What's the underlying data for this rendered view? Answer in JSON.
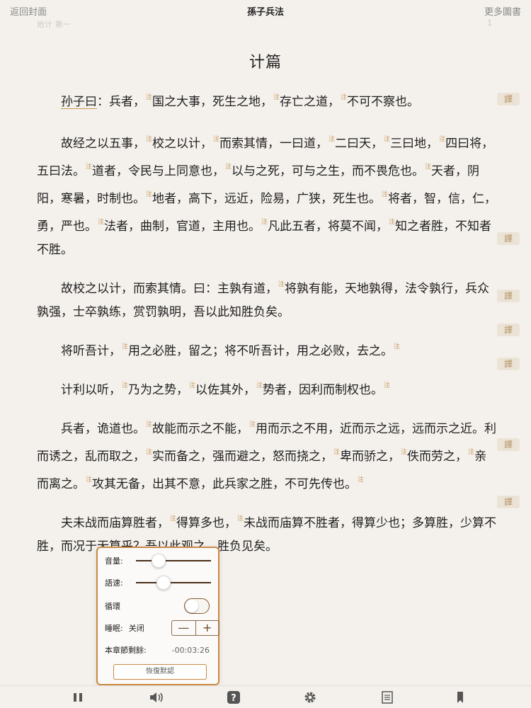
{
  "topbar": {
    "back_label": "返回封面",
    "title": "孫子兵法",
    "more_label": "更多圖書",
    "ghost_left": "始计 第一",
    "ghost_right": "1"
  },
  "chapter_title": "计篇",
  "translate_label": "譯",
  "note_mark": "注",
  "paragraphs": [
    {
      "s": [
        "孙子曰",
        "：兵者，",
        "国之大事，死生之地，",
        "存亡之道，",
        "不可不察也。"
      ]
    },
    {
      "s": [
        "故经之以五事，",
        "校之以计，",
        "而索其情，一曰道，",
        "二曰天，",
        "三曰地，",
        "四曰将，五曰法。",
        "道者，令民与上同意也，",
        "以与之死，可与之生，而不畏危也。",
        "天者，阴阳，寒暑，时制也。",
        "地者，高下，远近，险易，广狭，死生也。",
        "将者，智，信，仁，勇，严也。",
        "法者，曲制，官道，主用也。",
        "凡此五者，将莫不闻，",
        "知之者胜，不知者不胜。"
      ]
    },
    {
      "s": [
        "故校之以计，而索其情。曰：主孰有道，",
        "将孰有能，天地孰得，法令孰行，兵众孰强，士卒孰练，赏罚孰明，吾以此知胜负矣。"
      ]
    },
    {
      "s": [
        "将听吾计，",
        "用之必胜，留之；将不听吾计，用之必败，去之。"
      ]
    },
    {
      "s": [
        "计利以听，",
        "乃为之势，",
        "以佐其外，",
        "势者，因利而制权也。"
      ]
    },
    {
      "s": [
        "兵者，诡道也。",
        "故能而示之不能，",
        "用而示之不用，近而示之远，远而示之近。利而诱之，乱而取之，",
        "实而备之，强而避之，怒而挠之，",
        "卑而骄之，",
        "佚而劳之，",
        "亲而离之。",
        "攻其无备，出其不意，此兵家之胜，不可先传也。"
      ]
    },
    {
      "s": [
        "夫未战而庙算胜者，",
        "得算多也，",
        "未战而庙算不胜者，得算少也；多算胜，少算不胜，而况于无算乎？吾以此观之，胜负见矣。"
      ]
    }
  ],
  "audio_panel": {
    "volume_label": "音量:",
    "speed_label": "語速:",
    "loop_label": "循環",
    "sleep_label": "睡眠:",
    "sleep_value": "关闭",
    "stepper_minus": "—",
    "stepper_plus": "+",
    "remaining_label": "本章節剩餘:",
    "remaining_value": "-00:03:26",
    "restore_label": "恢復默認",
    "volume_level": 0.3,
    "speed_level": 0.37,
    "loop_on": false
  },
  "bottom_icons": [
    "pause-icon",
    "speaker-icon",
    "help-icon",
    "gear-icon",
    "contents-icon",
    "bookmark-icon"
  ],
  "colors": {
    "accent": "#c98a45",
    "background": "#f4f1ec",
    "text": "#1e1e1e"
  }
}
